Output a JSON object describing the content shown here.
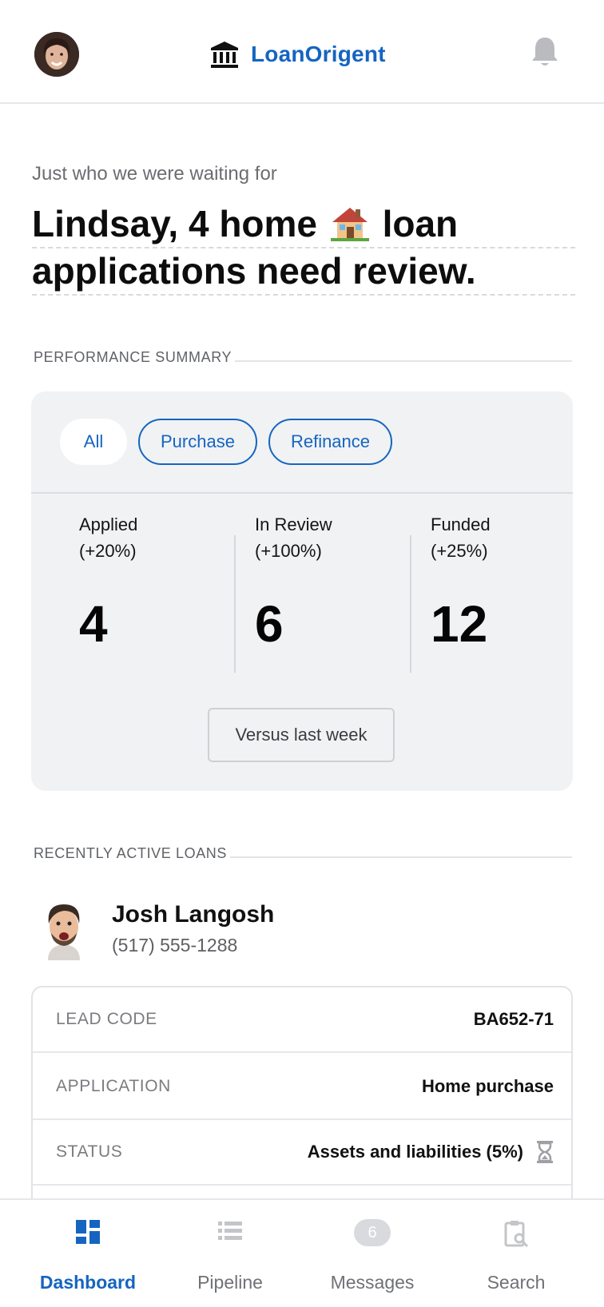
{
  "header": {
    "brand_name": "LoanOrigent",
    "brand_icon": "bank-icon",
    "notification_icon": "bell-icon",
    "accent_color": "#1565c0"
  },
  "greeting": {
    "subtitle": "Just who we were waiting for",
    "title_part1": "Lindsay, 4 home",
    "title_part2": "loan",
    "title_line2": "applications need review."
  },
  "performance": {
    "heading": "PERFORMANCE SUMMARY",
    "filters": [
      {
        "label": "All",
        "active": true
      },
      {
        "label": "Purchase",
        "active": false
      },
      {
        "label": "Refinance",
        "active": false
      }
    ],
    "stats": [
      {
        "label": "Applied",
        "change": "(+20%)",
        "value": "4"
      },
      {
        "label": "In Review",
        "change": "(+100%)",
        "value": "6"
      },
      {
        "label": "Funded",
        "change": "(+25%)",
        "value": "12"
      }
    ],
    "compare_button": "Versus last week"
  },
  "recent_loans": {
    "heading": "RECENTLY ACTIVE LOANS",
    "contact": {
      "name": "Josh Langosh",
      "phone": "(517) 555-1288"
    },
    "details": [
      {
        "key": "LEAD CODE",
        "value": "BA652-71"
      },
      {
        "key": "APPLICATION",
        "value": "Home purchase"
      },
      {
        "key": "STATUS",
        "value": "Assets and liabilities (5%)",
        "icon": "hourglass-icon"
      }
    ]
  },
  "bottom_nav": {
    "items": [
      {
        "label": "Dashboard",
        "icon": "dashboard-icon",
        "active": true
      },
      {
        "label": "Pipeline",
        "icon": "list-icon",
        "active": false
      },
      {
        "label": "Messages",
        "icon": "messages-badge",
        "badge": "6",
        "active": false
      },
      {
        "label": "Search",
        "icon": "clipboard-search-icon",
        "active": false
      }
    ]
  }
}
